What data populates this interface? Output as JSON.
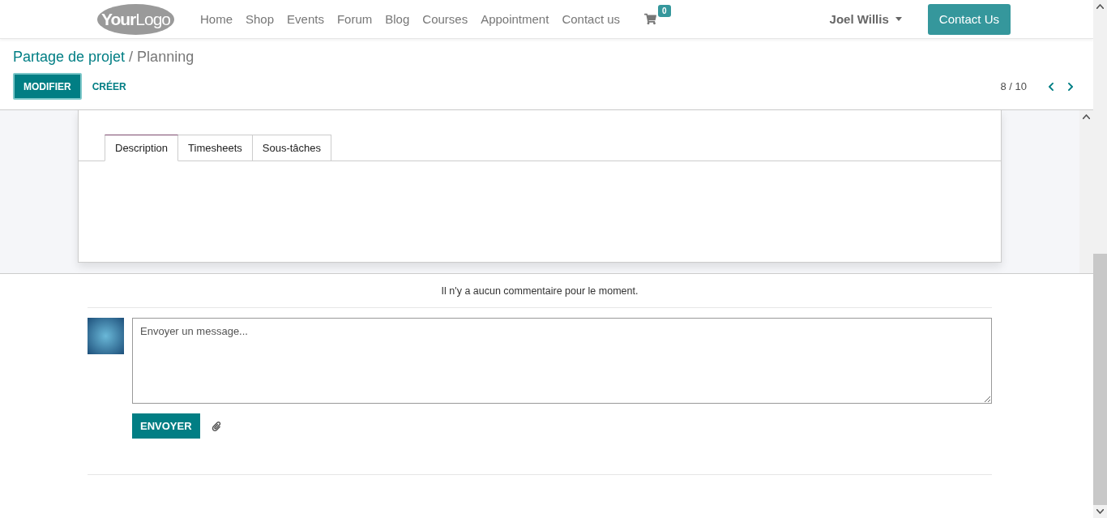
{
  "navbar": {
    "logo": "**Your**Logo",
    "menu": [
      {
        "label": "Home"
      },
      {
        "label": "Shop"
      },
      {
        "label": "Events"
      },
      {
        "label": "Forum"
      },
      {
        "label": "Blog"
      },
      {
        "label": "Courses"
      },
      {
        "label": "Appointment"
      },
      {
        "label": "Contact us"
      }
    ],
    "cart_count": "0",
    "user": "Joel Willis",
    "cta": "Contact Us"
  },
  "breadcrumb": {
    "parent": "Partage de projet",
    "separator": "/",
    "current": "Planning"
  },
  "actions": [
    {
      "label": "MODIFIER",
      "kind": "primary"
    },
    {
      "label": "CRÉER",
      "kind": "link"
    }
  ],
  "pager": {
    "value": "8 / 10"
  },
  "tabs": [
    {
      "label": "Description",
      "selected": true
    },
    {
      "label": "Timesheets",
      "selected": false
    },
    {
      "label": "Sous-tâches",
      "selected": false
    }
  ],
  "chatter": {
    "empty_message": "Il n'y a aucun commentaire pour le moment.",
    "composer": {
      "placeholder": "Envoyer un message..."
    },
    "send": "ENVOYER"
  }
}
